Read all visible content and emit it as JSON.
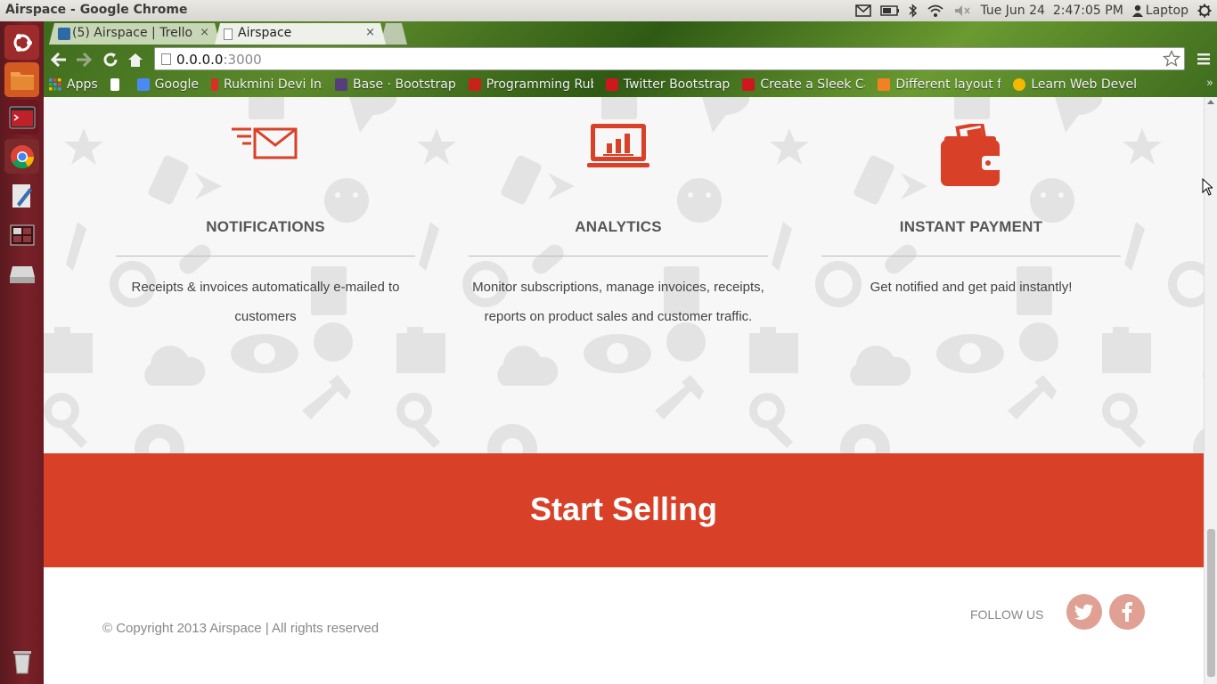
{
  "window": {
    "title": "Airspace - Google Chrome"
  },
  "panel": {
    "clock": "Tue Jun 24  2:47:05 PM",
    "user": "Laptop",
    "icons": [
      "mail-icon",
      "battery-icon",
      "bluetooth-icon",
      "wifi-icon",
      "volume-muted-icon",
      "power-icon"
    ]
  },
  "launcher": {
    "items": [
      "ubuntu-dash-icon",
      "files-icon",
      "terminal-icon",
      "chrome-icon",
      "text-editor-icon",
      "workspace-icon",
      "disk-icon",
      "trash-icon"
    ]
  },
  "browser": {
    "tabs": [
      {
        "label": "(5) Airspace | Trello",
        "active": false
      },
      {
        "label": "Airspace",
        "active": true
      }
    ],
    "tab_close": "×",
    "url_host": "0.0.0.0",
    "url_port": ":3000",
    "bookmarks": [
      {
        "label": "Apps",
        "color": "#4a8af4"
      },
      {
        "label": "",
        "color": "#ffffff"
      },
      {
        "label": "Google",
        "color": "#4a8af4"
      },
      {
        "label": "Rukmini Devi Insti",
        "color": "#d93025"
      },
      {
        "label": "Base · Bootstrap",
        "color": "#563d7c"
      },
      {
        "label": "Programming Ruby",
        "color": "#c9221a"
      },
      {
        "label": "Twitter Bootstrap",
        "color": "#cc181e"
      },
      {
        "label": "Create a Sleek Cale",
        "color": "#cc181e"
      },
      {
        "label": "Different layout fo",
        "color": "#f48024"
      },
      {
        "label": "Learn Web Develo",
        "color": "#f5b800"
      }
    ],
    "bookmarks_more": "»"
  },
  "page": {
    "accent": "#d84127",
    "features": [
      {
        "icon": "envelope-icon",
        "title": "NOTIFICATIONS",
        "desc": "Receipts & invoices automatically e-mailed to customers"
      },
      {
        "icon": "analytics-monitor-icon",
        "title": "ANALYTICS",
        "desc": "Monitor subscriptions, manage invoices, receipts, reports on product sales and customer traffic."
      },
      {
        "icon": "wallet-icon",
        "title": "INSTANT PAYMENT",
        "desc": "Get notified and get paid instantly!"
      }
    ],
    "cta": {
      "label": "Start Selling"
    },
    "footer": {
      "copyright": "© Copyright 2013 Airspace | All rights reserved",
      "follow_label": "FOLLOW US",
      "social": [
        "twitter-icon",
        "facebook-icon"
      ]
    }
  }
}
